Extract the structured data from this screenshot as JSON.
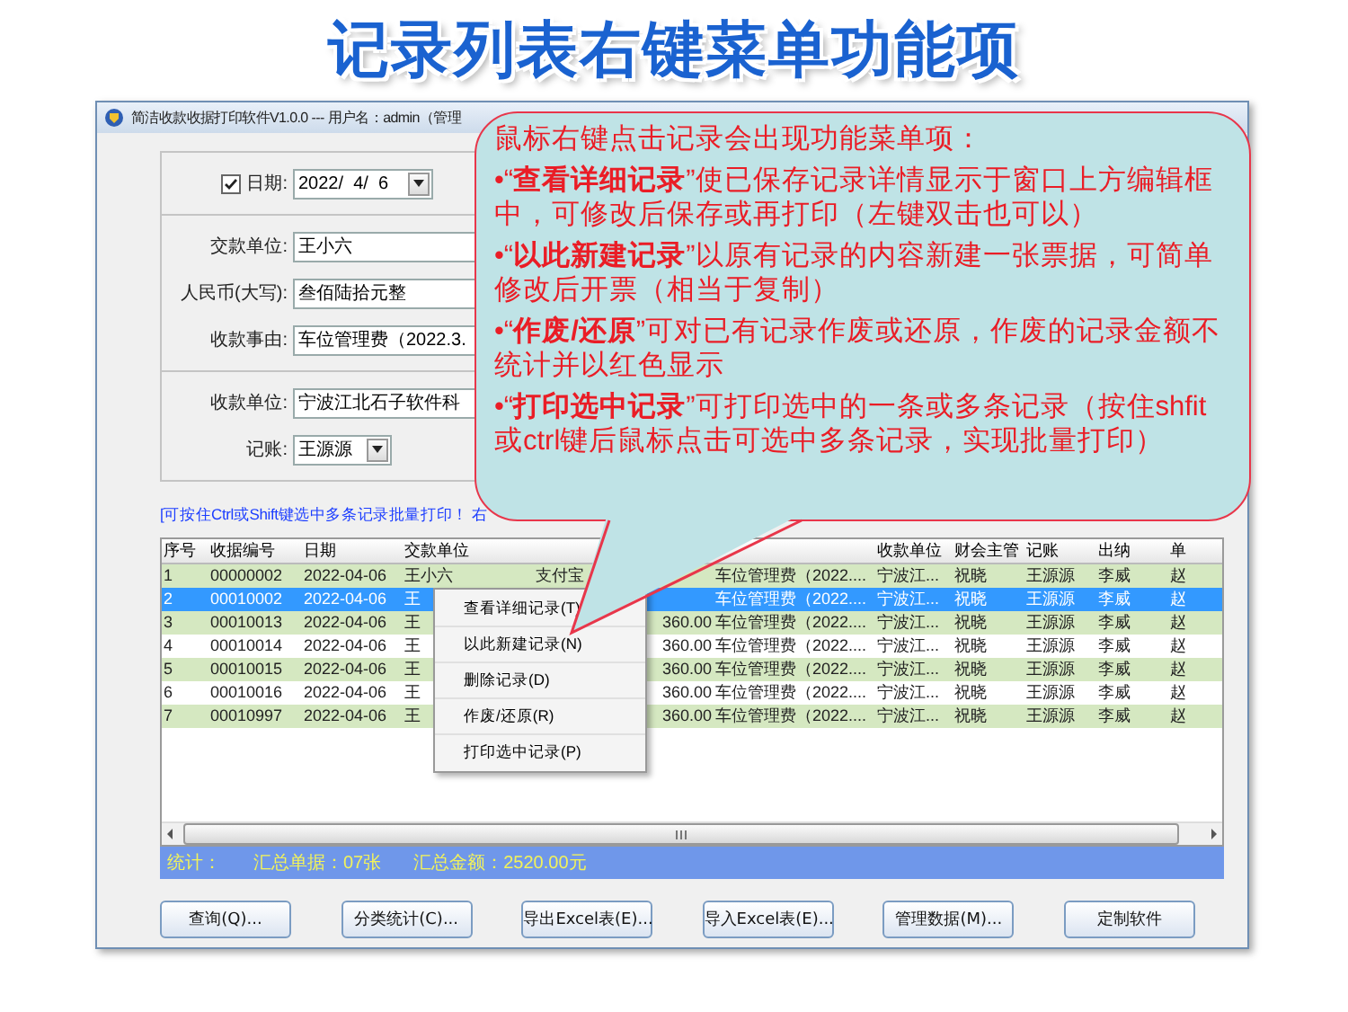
{
  "page_title": "记录列表右键菜单功能项",
  "window": {
    "title": "简洁收款收据打印软件V1.0.0 --- 用户名：admin（管理"
  },
  "form": {
    "groups": [
      {
        "rows": [
          {
            "kind": "date",
            "checked": true,
            "label": "日期:",
            "value": "2022/  4/  6"
          }
        ]
      },
      {
        "rows": [
          {
            "kind": "text",
            "label": "交款单位:",
            "value": "王小六"
          },
          {
            "kind": "text",
            "label": "人民币(大写):",
            "value": "叁佰陆拾元整"
          },
          {
            "kind": "text",
            "label": "收款事由:",
            "value": "车位管理费（2022.3."
          }
        ]
      },
      {
        "rows": [
          {
            "kind": "text",
            "label": "收款单位:",
            "value": "宁波江北石子软件科"
          },
          {
            "kind": "combo",
            "label": "记账:",
            "value": "王源源"
          }
        ]
      }
    ]
  },
  "hint": "[可按住Ctrl或Shift键选中多条记录批量打印！ 右",
  "table": {
    "columns": [
      "序号",
      "收据编号",
      "日期",
      "交款单位",
      null,
      null,
      null,
      "收款单位",
      "财会主管",
      "记账",
      "出纳",
      "单"
    ],
    "rows": [
      {
        "selected": false,
        "cells": [
          "1",
          "00000002",
          "2022-04-06",
          "王小六",
          "支付宝",
          null,
          "车位管理费（2022....",
          "宁波江...",
          "祝晓",
          "王源源",
          "李威",
          "赵"
        ]
      },
      {
        "selected": true,
        "cells": [
          "2",
          "00010002",
          "2022-04-06",
          "王",
          null,
          null,
          "车位管理费（2022....",
          "宁波江...",
          "祝晓",
          "王源源",
          "李威",
          "赵"
        ]
      },
      {
        "selected": false,
        "cells": [
          "3",
          "00010013",
          "2022-04-06",
          "王",
          null,
          "360.00",
          "车位管理费（2022....",
          "宁波江...",
          "祝晓",
          "王源源",
          "李威",
          "赵"
        ]
      },
      {
        "selected": false,
        "cells": [
          "4",
          "00010014",
          "2022-04-06",
          "王",
          null,
          "360.00",
          "车位管理费（2022....",
          "宁波江...",
          "祝晓",
          "王源源",
          "李威",
          "赵"
        ]
      },
      {
        "selected": false,
        "cells": [
          "5",
          "00010015",
          "2022-04-06",
          "王",
          null,
          "360.00",
          "车位管理费（2022....",
          "宁波江...",
          "祝晓",
          "王源源",
          "李威",
          "赵"
        ]
      },
      {
        "selected": false,
        "cells": [
          "6",
          "00010016",
          "2022-04-06",
          "王",
          null,
          "360.00",
          "车位管理费（2022....",
          "宁波江...",
          "祝晓",
          "王源源",
          "李威",
          "赵"
        ]
      },
      {
        "selected": false,
        "cells": [
          "7",
          "00010997",
          "2022-04-06",
          "王",
          null,
          "360.00",
          "车位管理费（2022....",
          "宁波江...",
          "祝晓",
          "王源源",
          "李威",
          "赵"
        ]
      }
    ]
  },
  "context_menu": [
    "查看详细记录(T)",
    "以此新建记录(N)",
    "删除记录(D)",
    "作废/还原(R)",
    "打印选中记录(P)"
  ],
  "status_bar": [
    "统计：",
    "汇总单据：07张",
    "汇总金额：2520.00元"
  ],
  "buttons": [
    "查询(Q)...",
    "分类统计(C)...",
    "导出Excel表(E)...",
    "导入Excel表(E)...",
    "管理数据(M)...",
    "定制软件"
  ],
  "callout": {
    "heading": "鼠标右键点击记录会出现功能菜单项：",
    "items": [
      "•“**查看详细记录**”使已保存记录详情显示于窗口上方编辑框中，可修改后保存或再打印（左键双击也可以）",
      "•“**以此新建记录**”以原有记录的内容新建一张票据，可简单修改后开票（相当于复制）",
      "•“**作废/还原**”可对已有记录作废或还原，作废的记录金额不统计并以红色显示",
      "•“**打印选中记录**”可打印选中的一条或多条记录（按住shfit或ctrl键后鼠标点击可选中多条记录，实现批量打印）"
    ]
  }
}
